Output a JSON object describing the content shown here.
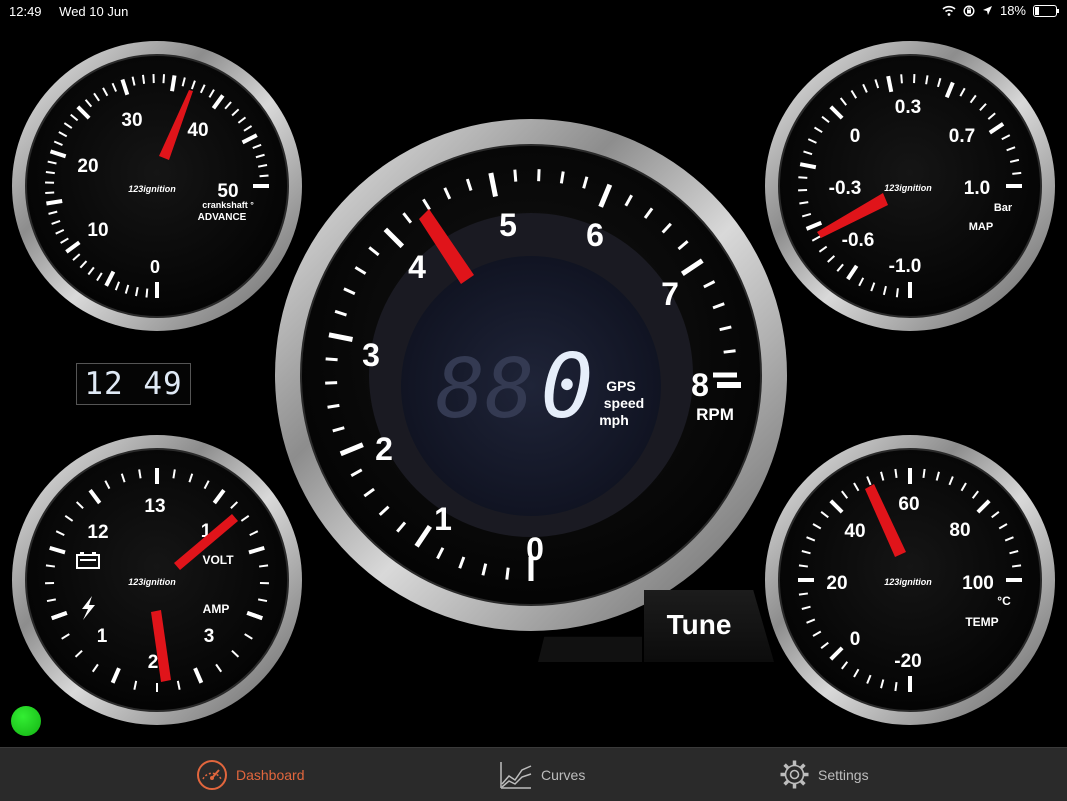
{
  "status_bar": {
    "time": "12:49",
    "date": "Wed 10 Jun",
    "battery": "18%",
    "battery_level": 0.18
  },
  "clock": "12 49",
  "gauges": {
    "advance": {
      "labels": [
        "0",
        "10",
        "20",
        "30",
        "40",
        "50"
      ],
      "brand": "123ignition",
      "title_1": "crankshaft °",
      "title_2": "ADVANCE",
      "needle_value": 38
    },
    "map": {
      "labels": [
        "-1.0",
        "-0.6",
        "-0.3",
        "0",
        "0.3",
        "0.7",
        "1.0"
      ],
      "brand": "123ignition",
      "unit": "Bar",
      "title": "MAP",
      "needle_value": -0.6
    },
    "rpm": {
      "labels": [
        "0",
        "1",
        "2",
        "3",
        "4",
        "5",
        "6",
        "7",
        "8"
      ],
      "title": "RPM",
      "needle_value": 4.3,
      "digits_dim": "88",
      "speed_value": "0",
      "speed_label_1": "GPS",
      "speed_label_2": "speed",
      "speed_label_3": "mph"
    },
    "volt_amp": {
      "volt_labels": [
        "12",
        "13",
        "1"
      ],
      "amp_labels": [
        "1",
        "2",
        "3"
      ],
      "brand": "123ignition",
      "volt_title": "VOLT",
      "amp_title": "AMP",
      "battery_icon": "battery-icon",
      "lightning_icon": "lightning-icon"
    },
    "temp": {
      "labels": [
        "-20",
        "0",
        "20",
        "40",
        "60",
        "80",
        "100"
      ],
      "brand": "123ignition",
      "unit": "°C",
      "title": "TEMP",
      "needle_value": 50
    }
  },
  "tune_button": "Tune",
  "tabs": [
    {
      "label": "Dashboard",
      "icon": "speedometer-icon",
      "active": true
    },
    {
      "label": "Curves",
      "icon": "chart-icon",
      "active": false
    },
    {
      "label": "Settings",
      "icon": "gear-icon",
      "active": false
    }
  ],
  "colors": {
    "accent": "#e2663d",
    "needle": "#e0141a",
    "led": "#1fce1f",
    "tab_bar": "#2a2a2a"
  }
}
